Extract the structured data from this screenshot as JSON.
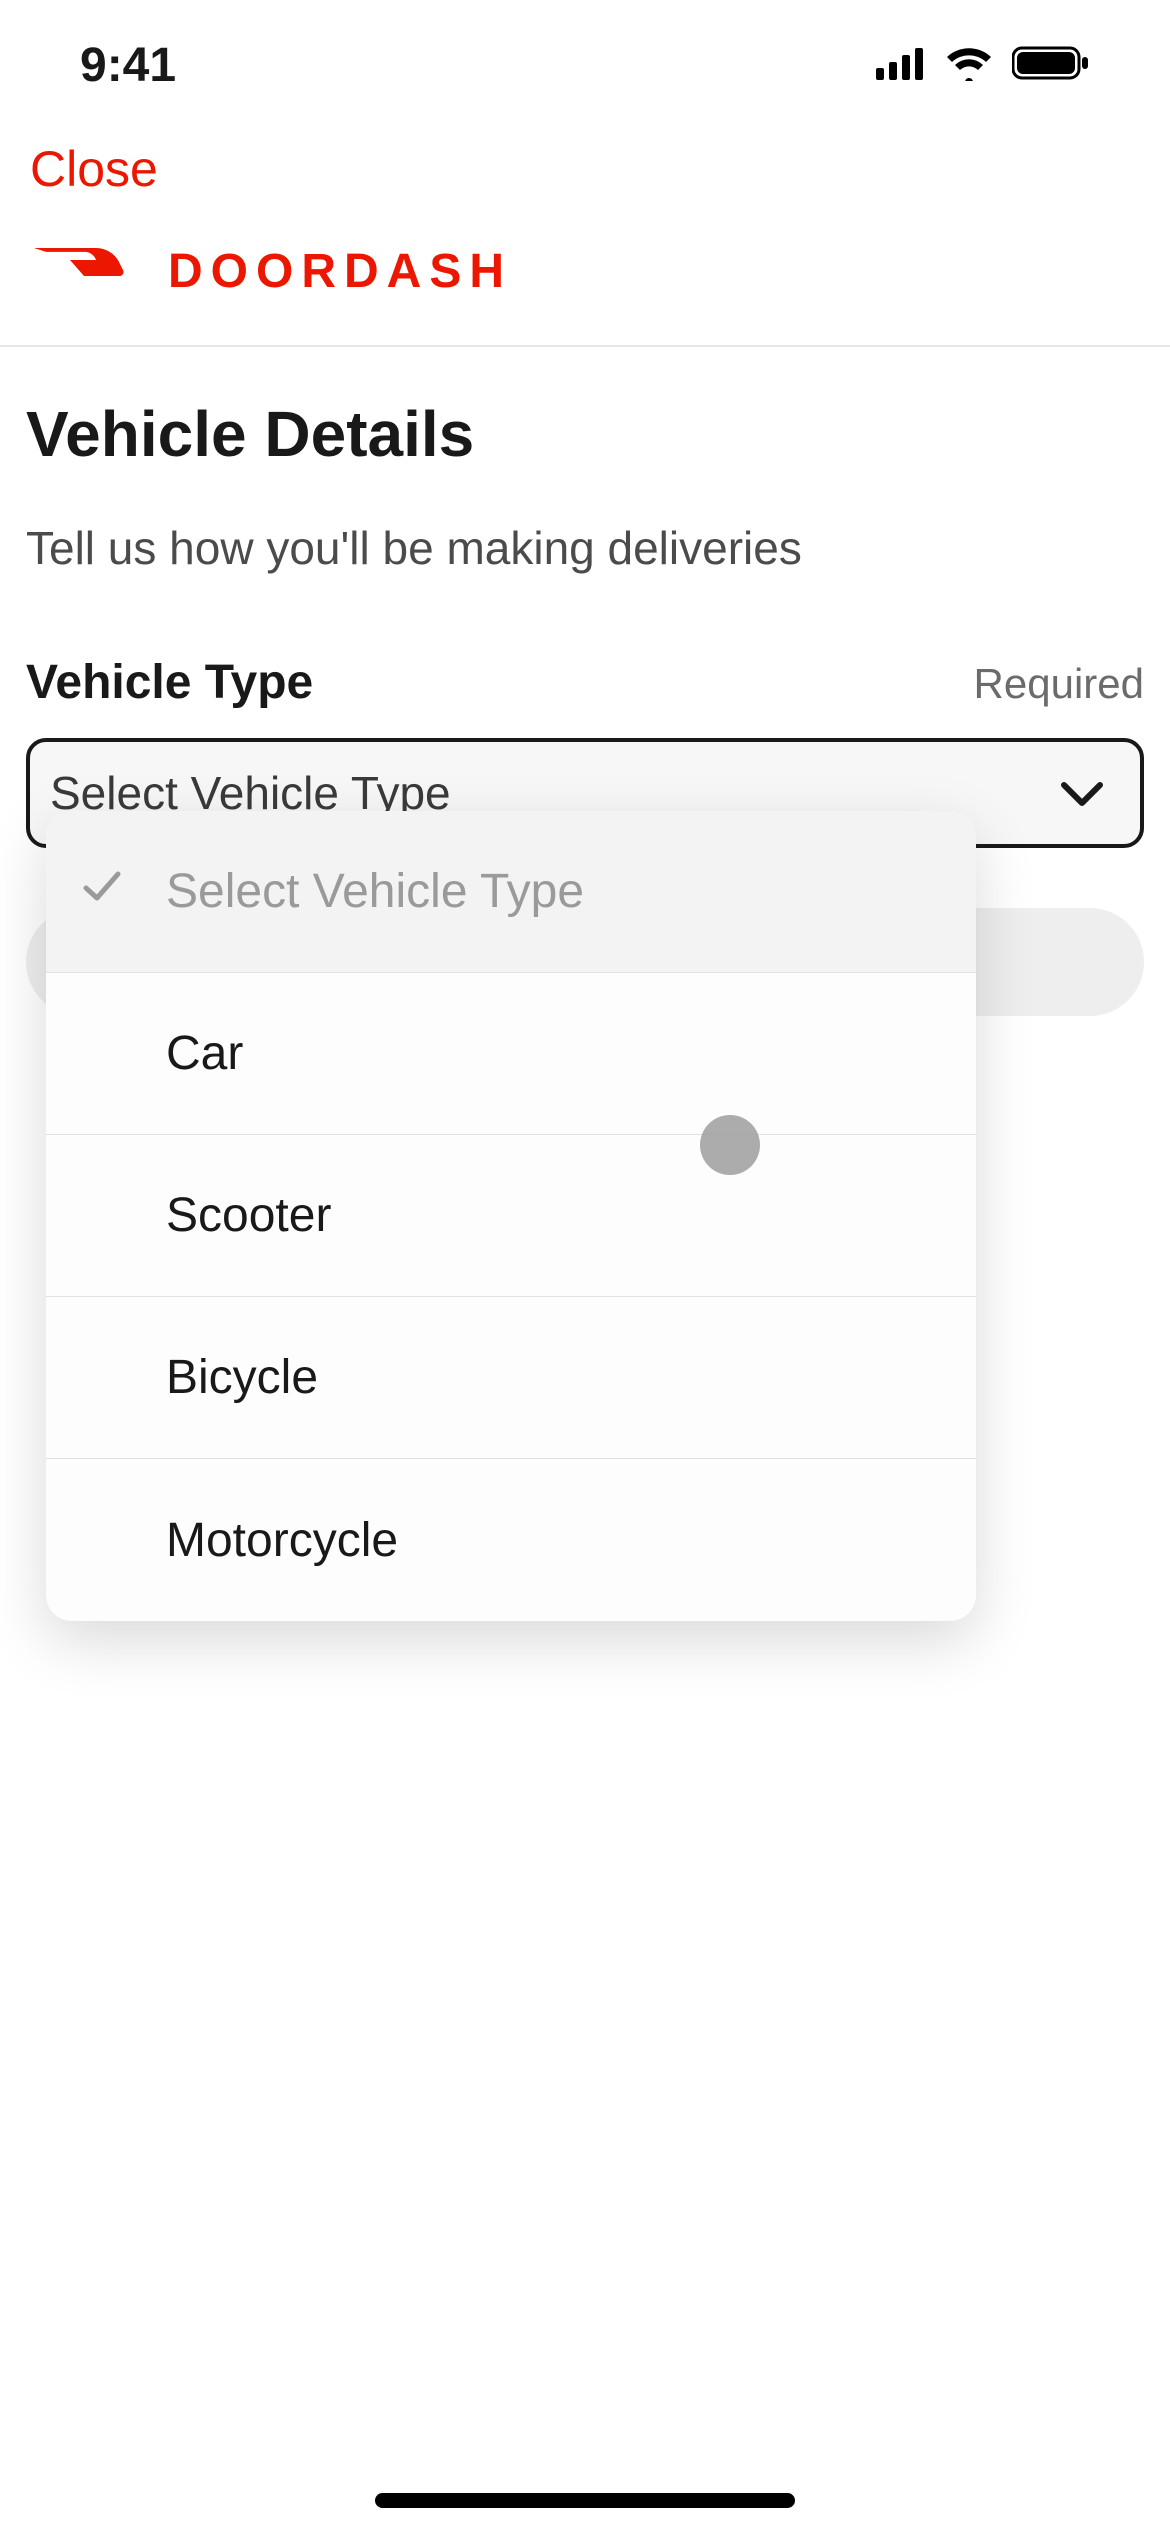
{
  "status": {
    "time": "9:41"
  },
  "nav": {
    "close": "Close"
  },
  "brand": {
    "name": "DOORDASH"
  },
  "page": {
    "title": "Vehicle Details",
    "subtitle": "Tell us how you'll be making deliveries"
  },
  "form": {
    "vehicle_type": {
      "label": "Vehicle Type",
      "required_text": "Required",
      "placeholder": "Select Vehicle Type",
      "selected": "Select Vehicle Type",
      "options": [
        "Select Vehicle Type",
        "Car",
        "Scooter",
        "Bicycle",
        "Motorcycle"
      ]
    }
  }
}
